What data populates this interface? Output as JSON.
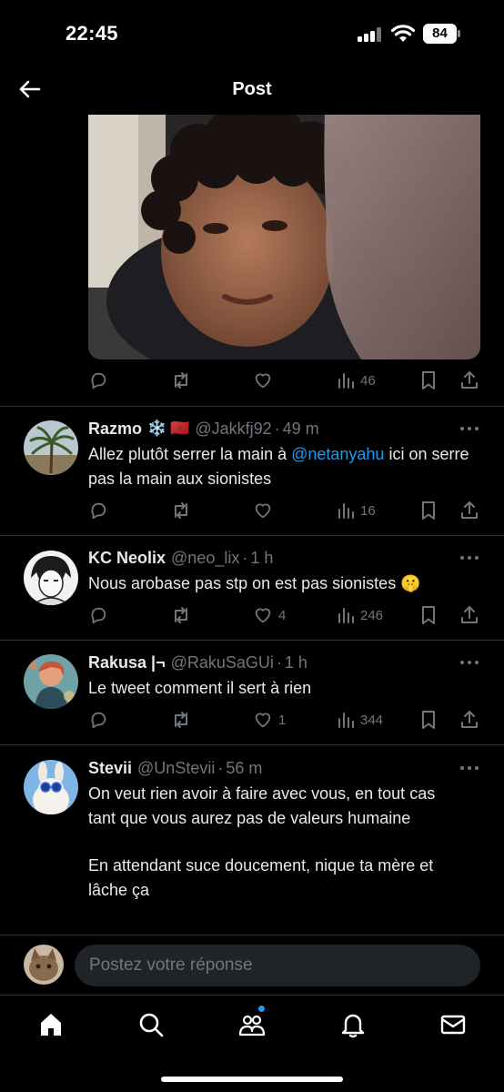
{
  "status_bar": {
    "time": "22:45",
    "battery": "84"
  },
  "header": {
    "title": "Post"
  },
  "original_post": {
    "views": "46"
  },
  "replies": [
    {
      "name": "Razmo",
      "badges": [
        "❄️",
        "🇲🇦"
      ],
      "handle": "@Jakkfj92",
      "time": "49 m",
      "text_before": "Allez plutôt serrer la main à ",
      "mention": "@netanyahu",
      "text_after": " ici on serre pas la main aux sionistes",
      "likes": "",
      "views": "16"
    },
    {
      "name": "KC Neolix",
      "handle": "@neo_lix",
      "time": "1 h",
      "text": "Nous arobase pas stp on est pas sionistes 🤫",
      "likes": "4",
      "views": "246"
    },
    {
      "name": "Rakusa |¬",
      "handle": "@RakuSaGUi",
      "time": "1 h",
      "text": "Le tweet comment il sert à rien",
      "likes": "1",
      "views": "344"
    },
    {
      "name": "Stevii",
      "handle": "@UnStevii",
      "time": "56 m",
      "text_line1": "On veut rien avoir à faire avec vous, en tout cas tant que vous aurez pas de valeurs humaine",
      "text_line2": "En attendant suce doucement, nique ta mère et lâche ça"
    }
  ],
  "reply_bar": {
    "placeholder": "Postez votre réponse"
  },
  "tabs": [
    {
      "icon": "home-icon"
    },
    {
      "icon": "search-icon"
    },
    {
      "icon": "communities-icon"
    },
    {
      "icon": "bell-icon"
    },
    {
      "icon": "mail-icon"
    }
  ],
  "colors": {
    "background": "#000000",
    "text": "#e7e9ea",
    "muted": "#71767b",
    "accent": "#1d9bf0",
    "divider": "#2f3336"
  }
}
